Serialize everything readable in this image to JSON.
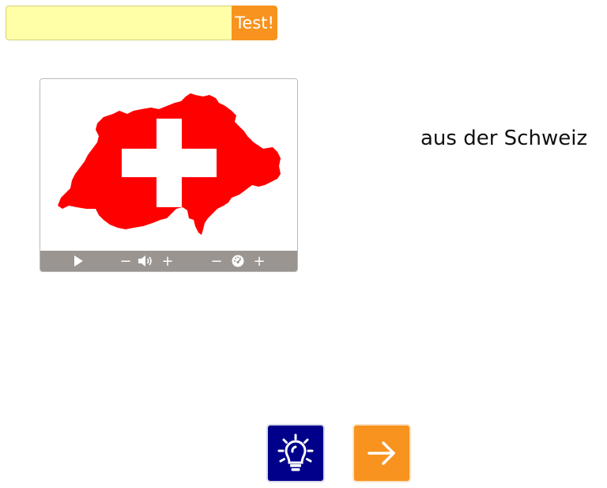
{
  "answer": {
    "value": "",
    "placeholder": "",
    "test_label": "Test!"
  },
  "media": {
    "image": "switzerland-flag-map",
    "controls": {
      "play_icon": "play-icon",
      "volume_down_label": "−",
      "volume_icon": "speaker-icon",
      "volume_up_label": "+",
      "speed_down_label": "−",
      "speed_icon": "speedometer-icon",
      "speed_up_label": "+"
    }
  },
  "prompt": {
    "text": "aus der Schweiz"
  },
  "buttons": {
    "hint_icon": "lightbulb-icon",
    "next_icon": "arrow-right-icon"
  },
  "colors": {
    "input_bg": "#ffffa8",
    "accent_orange": "#f7931e",
    "hint_navy": "#00008a",
    "flag_red": "#ff0000",
    "controls_bg": "#9a9590"
  }
}
